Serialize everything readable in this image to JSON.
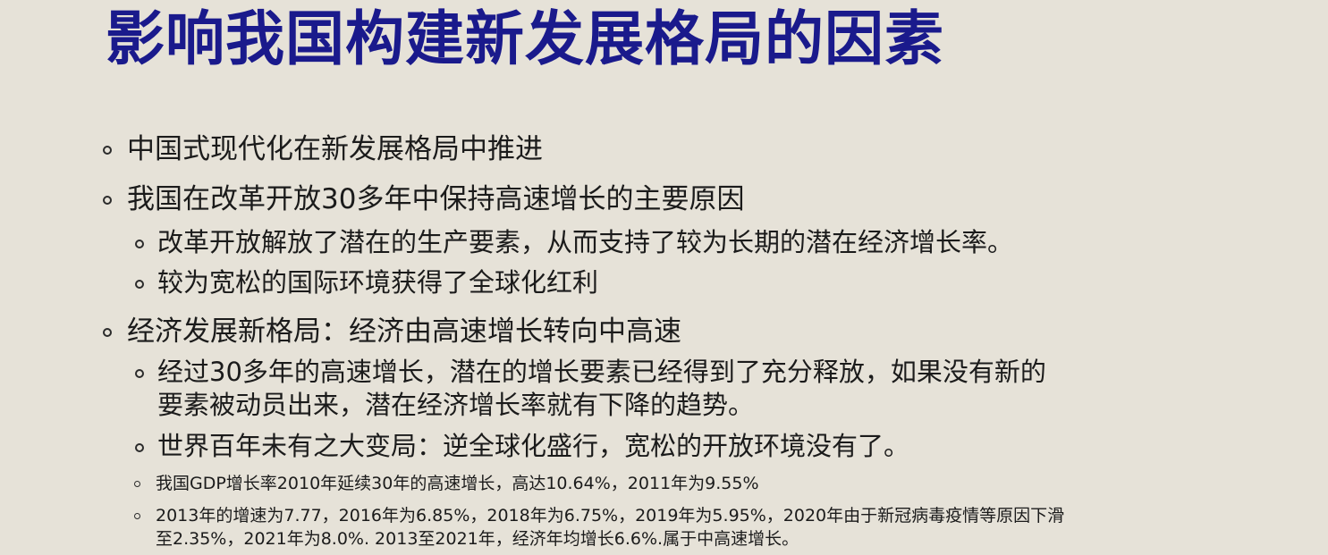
{
  "slide": {
    "title": "影响我国构建新发展格局的因素",
    "bullets": [
      {
        "text": "中国式现代化在新发展格局中推进"
      },
      {
        "text": "我国在改革开放30多年中保持高速增长的主要原因"
      },
      {
        "text": "改革开放解放了潜在的生产要素，从而支持了较为长期的潜在经济增长率。"
      },
      {
        "text": "较为宽松的国际环境获得了全球化红利"
      },
      {
        "text": "经济发展新格局：经济由高速增长转向中高速"
      },
      {
        "line1": "经过30多年的高速增长，潜在的增长要素已经得到了充分释放，如果没有新的",
        "line2": "要素被动员出来，潜在经济增长率就有下降的趋势。"
      },
      {
        "text": "世界百年未有之大变局：逆全球化盛行，宽松的开放环境没有了。"
      },
      {
        "text": "我国GDP增长率2010年延续30年的高速增长，高达10.64%，2011年为9.55%"
      },
      {
        "line1": "2013年的增速为7.77，2016年为6.85%，2018年为6.75%，2019年为5.95%，2020年由于新冠病毒疫情等原因下滑",
        "line2": "至2.35%，2021年为8.0%. 2013至2021年，经济年均增长6.6%.属于中高速增长。"
      }
    ]
  }
}
